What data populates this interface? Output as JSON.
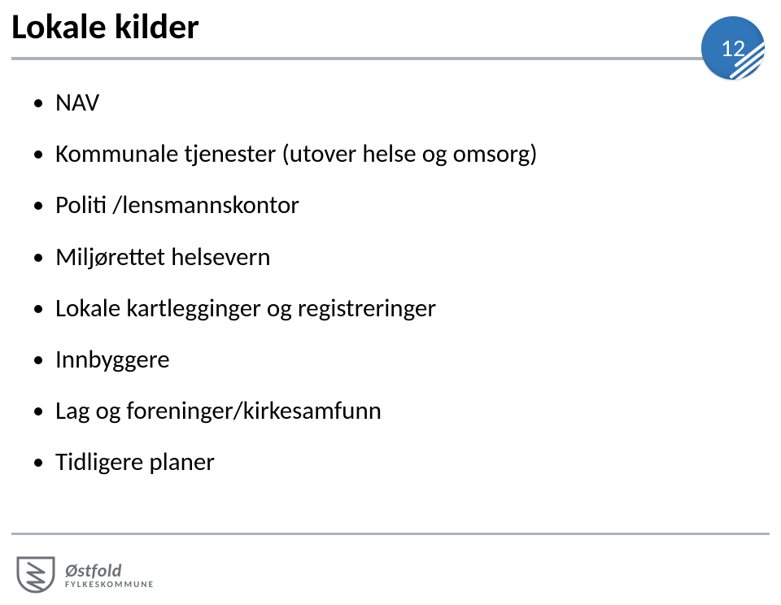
{
  "title": "Lokale kilder",
  "page_number": "12",
  "bullets": [
    "NAV",
    "Kommunale tjenester (utover helse og omsorg)",
    "Politi /lensmannskontor",
    "Miljørettet helsevern",
    "Lokale kartlegginger og registreringer",
    "Innbyggere",
    "Lag og foreninger/kirkesamfunn",
    "Tidligere planer"
  ],
  "logo": {
    "name": "Østfold",
    "subtitle": "FYLKESKOMMUNE"
  },
  "colors": {
    "badge_bg": "#3276ba",
    "rule": "#a9b4bd",
    "logo_text": "#6b7177"
  }
}
